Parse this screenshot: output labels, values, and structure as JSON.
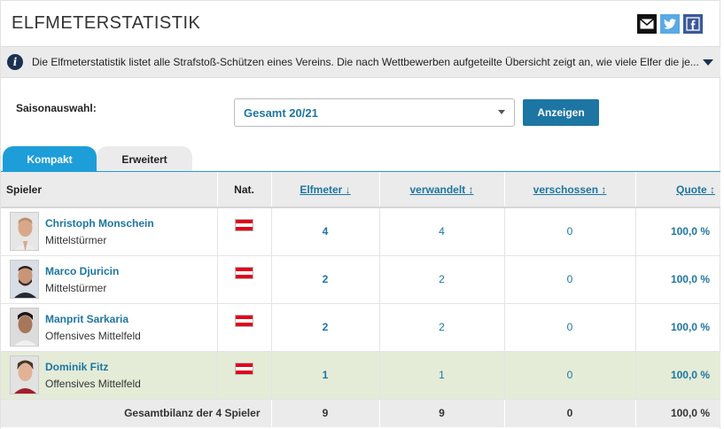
{
  "page": {
    "title": "ELFMETERSTATISTIK",
    "info_text": "Die Elfmeterstatistik listet alle Strafstoß-Schützen eines Vereins. Die nach Wettbewerben aufgeteilte Übersicht zeigt an, wie viele Elfer die je..."
  },
  "share": {
    "icons": [
      "mail-icon",
      "twitter-icon",
      "facebook-icon"
    ]
  },
  "filter": {
    "season_label": "Saisonauswahl:",
    "season_value": "Gesamt 20/21",
    "button_label": "Anzeigen"
  },
  "tabs": [
    {
      "label": "Kompakt",
      "active": true
    },
    {
      "label": "Erweitert",
      "active": false
    }
  ],
  "table": {
    "headers": {
      "player": "Spieler",
      "nat": "Nat.",
      "penalties": "Elfmeter ↓",
      "scored": "verwandelt ↕",
      "missed": "verschossen ↕",
      "quote": "Quote ↕"
    },
    "rows": [
      {
        "name": "Christoph Monschein",
        "position": "Mittelstürmer",
        "nation": "Austria",
        "penalties": "4",
        "scored": "4",
        "missed": "0",
        "quote": "100,0 %"
      },
      {
        "name": "Marco Djuricin",
        "position": "Mittelstürmer",
        "nation": "Austria",
        "penalties": "2",
        "scored": "2",
        "missed": "0",
        "quote": "100,0 %"
      },
      {
        "name": "Manprit Sarkaria",
        "position": "Offensives Mittelfeld",
        "nation": "Austria",
        "penalties": "2",
        "scored": "2",
        "missed": "0",
        "quote": "100,0 %"
      },
      {
        "name": "Dominik Fitz",
        "position": "Offensives Mittelfeld",
        "nation": "Austria",
        "penalties": "1",
        "scored": "1",
        "missed": "0",
        "quote": "100,0 %"
      }
    ],
    "total": {
      "label": "Gesamtbilanz der 4 Spieler",
      "penalties": "9",
      "scored": "9",
      "missed": "0",
      "quote": "100,0 %"
    }
  },
  "colors": {
    "accent_blue": "#1d75a3",
    "tab_active": "#1d9ed9",
    "highlight_row": "#e4ecd8",
    "austria_red": "#e2001a"
  }
}
